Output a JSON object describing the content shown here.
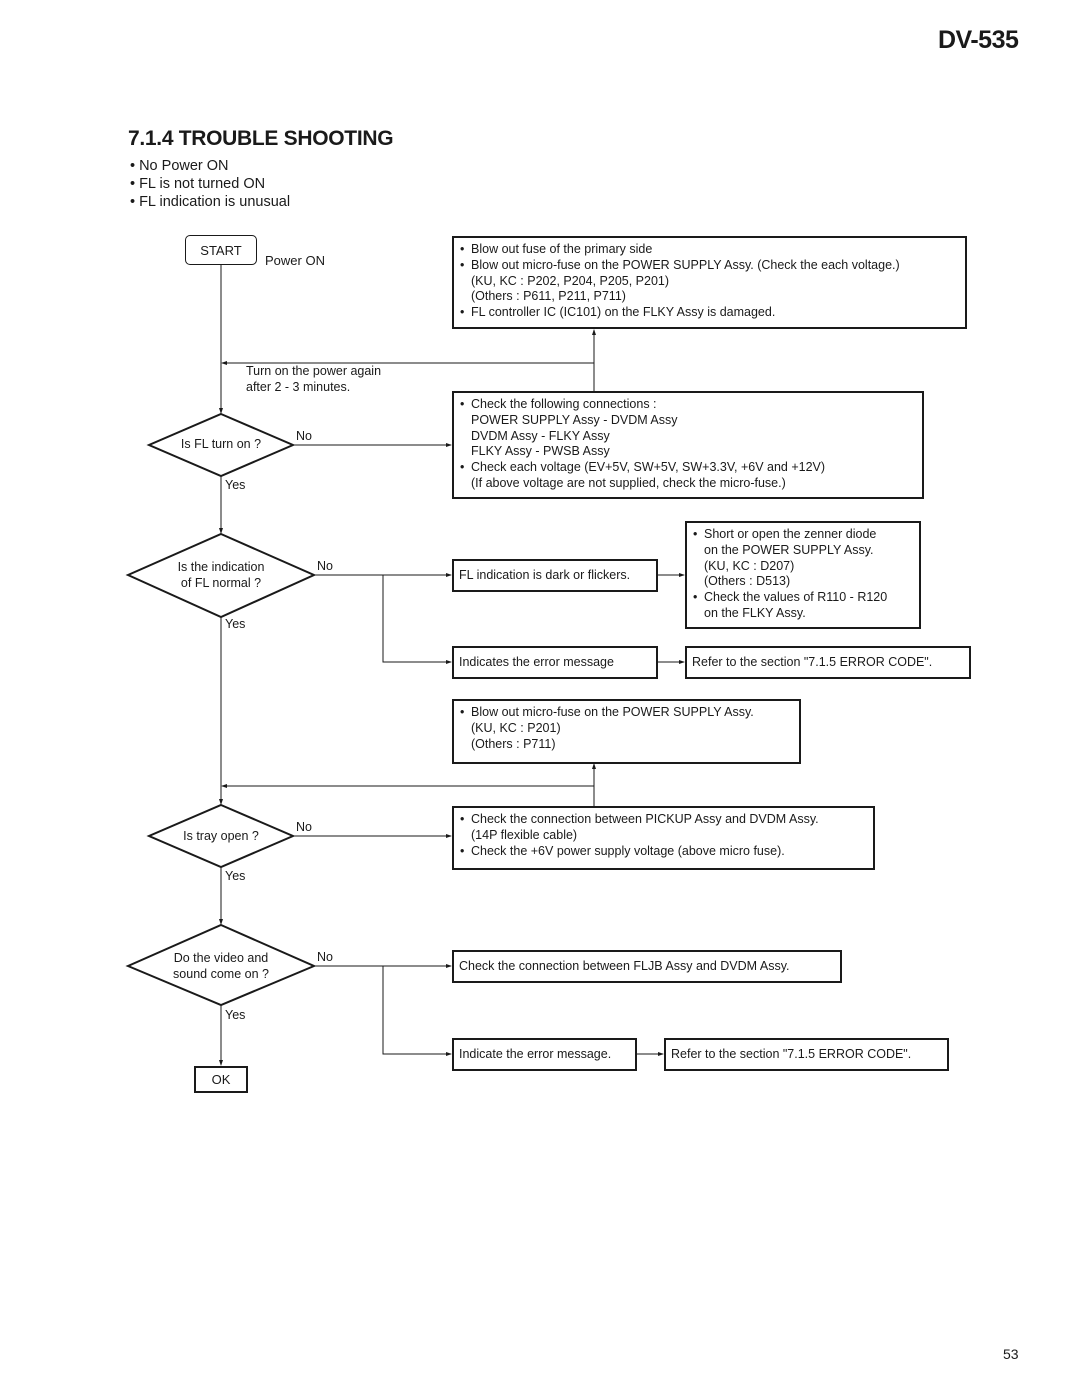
{
  "header": {
    "model": "DV-535"
  },
  "section": {
    "title": "7.1.4 TROUBLE SHOOTING",
    "symptoms": [
      "No Power ON",
      "FL is not turned ON",
      "FL indication is unusual"
    ]
  },
  "flow": {
    "start": {
      "label": "START",
      "note": "Power ON"
    },
    "retry_note": [
      "Turn on the power again",
      "after 2 - 3 minutes."
    ],
    "decisions": [
      {
        "lines": [
          "Is FL turn on ?"
        ],
        "no": "No",
        "yes": "Yes"
      },
      {
        "lines": [
          "Is the indication",
          "of FL normal ?"
        ],
        "no": "No",
        "yes": "Yes"
      },
      {
        "lines": [
          "Is tray open ?"
        ],
        "no": "No",
        "yes": "Yes"
      },
      {
        "lines": [
          "Do the video and",
          "sound come on ?"
        ],
        "no": "No",
        "yes": "Yes"
      }
    ],
    "boxes": {
      "fuse_primary": [
        {
          "bullet": true,
          "text": "Blow out fuse of the primary side"
        },
        {
          "bullet": true,
          "text": "Blow out micro-fuse on the POWER SUPPLY Assy. (Check the each voltage.)"
        },
        {
          "bullet": false,
          "text": "(KU, KC : P202, P204, P205, P201)"
        },
        {
          "bullet": false,
          "text": "(Others : P611, P211, P711)"
        },
        {
          "bullet": true,
          "text": "FL controller IC (IC101) on the FLKY Assy is damaged."
        }
      ],
      "check_connections": [
        {
          "bullet": true,
          "text": "Check the following connections :"
        },
        {
          "bullet": false,
          "text": "POWER SUPPLY Assy - DVDM Assy"
        },
        {
          "bullet": false,
          "text": "DVDM Assy - FLKY Assy"
        },
        {
          "bullet": false,
          "text": "FLKY Assy - PWSB Assy"
        },
        {
          "bullet": true,
          "text": "Check each voltage (EV+5V, SW+5V, SW+3.3V, +6V and +12V)"
        },
        {
          "bullet": false,
          "text": "(If above voltage are not supplied, check the micro-fuse.)"
        }
      ],
      "fl_dark": "FL indication is dark or flickers.",
      "zenner": [
        {
          "bullet": true,
          "text": "Short or open the zenner diode"
        },
        {
          "bullet": false,
          "text": "on the POWER SUPPLY Assy."
        },
        {
          "bullet": false,
          "text": "(KU, KC : D207)"
        },
        {
          "bullet": false,
          "text": "(Others : D513)"
        },
        {
          "bullet": true,
          "text": "Check the values of R110 - R120"
        },
        {
          "bullet": false,
          "text": "on the FLKY Assy."
        }
      ],
      "error_msg_1": "Indicates the error message",
      "refer_1": "Refer to the section \"7.1.5 ERROR CODE\".",
      "micro_fuse": [
        {
          "bullet": true,
          "text": "Blow out micro-fuse on the POWER SUPPLY Assy."
        },
        {
          "bullet": false,
          "text": "(KU, KC : P201)"
        },
        {
          "bullet": false,
          "text": "(Others : P711)"
        }
      ],
      "pickup": [
        {
          "bullet": true,
          "text": "Check the connection between PICKUP Assy and DVDM Assy."
        },
        {
          "bullet": false,
          "text": "(14P flexible cable)"
        },
        {
          "bullet": true,
          "text": "Check the +6V power supply voltage (above micro fuse)."
        }
      ],
      "fljb": "Check the connection between FLJB Assy and DVDM Assy.",
      "error_msg_2": "Indicate the error message.",
      "refer_2": "Refer to the section \"7.1.5 ERROR CODE\"."
    },
    "end": "OK"
  },
  "footer": {
    "page": "53"
  }
}
